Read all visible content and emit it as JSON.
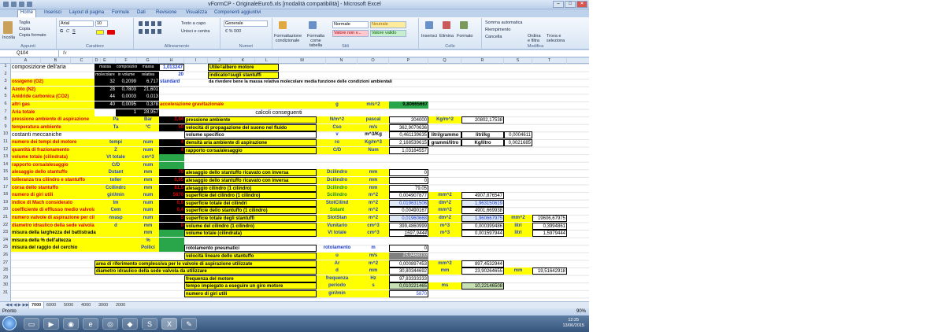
{
  "window": {
    "title": "vFormCP - OriginaleEuro5.xls [modalità compatibilità] - Microsoft Excel"
  },
  "tabs": [
    "Home",
    "Inserisci",
    "Layout di pagina",
    "Formule",
    "Dati",
    "Revisione",
    "Visualizza",
    "Componenti aggiuntivi"
  ],
  "ribbon": {
    "paste": "Incolla",
    "cut": "Taglia",
    "copy": "Copia",
    "format_painter": "Copia formato",
    "clipboard": "Appunti",
    "font_name": "Arial",
    "font_size": "10",
    "font_group": "Carattere",
    "wrap_text": "Testo a capo",
    "merge": "Unisci e centra",
    "align_group": "Allineamento",
    "number_format": "Generale",
    "number_group": "Numeri",
    "cond_format": "Formattazione condizionale",
    "format_table": "Formatta come tabella",
    "style_normal": "Normale",
    "style_neutral": "Neutrale",
    "style_bad": "Valore non v...",
    "style_good": "Valore valido",
    "styles_group": "Stili",
    "insert": "Inserisci",
    "delete": "Elimina",
    "format": "Formato",
    "cells_group": "Celle",
    "autosum": "Somma automatica",
    "fill": "Riempimento",
    "clear": "Cancella",
    "sort": "Ordina e filtra",
    "find": "Trova e seleziona",
    "edit_group": "Modifica"
  },
  "formula_bar": {
    "name_box": "Q104",
    "fx": "fx"
  },
  "columns": [
    "A",
    "B",
    "C",
    "D",
    "E",
    "F",
    "G",
    "H",
    "I",
    "J",
    "K",
    "L",
    "M",
    "N",
    "O",
    "P",
    "Q",
    "R",
    "S",
    "T"
  ],
  "rows": [
    "1",
    "2",
    "3",
    "4",
    "5",
    "6",
    "7",
    "8",
    "9",
    "10",
    "11",
    "12",
    "13",
    "14",
    "15",
    "16",
    "17",
    "18",
    "19",
    "20",
    "21",
    "22",
    "23",
    "24",
    "25",
    "26",
    "27",
    "28",
    "29",
    "30",
    "31"
  ],
  "cells": {
    "r1a": "composizione dell'aria",
    "r1e": "massa",
    "r1f": "composizione",
    "r1g": "massa",
    "r1h": "1,013247",
    "r1utile": "Utile=albero motore",
    "r2e": "molecolare",
    "r2f": "in volume",
    "r2g": "relativa",
    "r2h": "20",
    "r2ind": "indicato=sugli stantuffi",
    "r3a": "ossigeno (O2)",
    "r3e": "32",
    "r3f": "0,2099",
    "r3g": "6,717",
    "r3h": "standard",
    "r3note": "da rivedere bene la massa relativa molecolare media funzione delle condizioni ambientali",
    "r4a": "Azoto (N2)",
    "r4e": "28",
    "r4f": "0,7803",
    "r4g": "21,601",
    "r5a": "Anidride carbonica (CO2)",
    "r5e": "44",
    "r5f": "0,0003",
    "r5g": "0,013",
    "r6a": "altri gas",
    "r6e": "40",
    "r6f": "0,0095",
    "r6g": "0,378",
    "r6i": "accelerazione gravitazionale",
    "r6n": "g",
    "r6o": "m/s^2",
    "r6p": "9,80665667",
    "r7a": "Aria totale",
    "r7f": "1",
    "r7g": "28,957",
    "r7calc": "calcoli conseguenti",
    "r8a": "pressione ambiente di aspirazione",
    "r8e": "Pa",
    "r8g": "Bar",
    "r8h": "2,04",
    "r8i": "pressione ambiente",
    "r8n": "N/m^2",
    "r8o": "pascal",
    "r8p": "204000",
    "r8q": "Kg/m^2",
    "r8r": "20802,17538",
    "r9a": "temperatura ambiente",
    "r9e": "Ta",
    "r9g": "°C",
    "r9h": "50",
    "r9i": "velocità di propagazione del suono nel fluido",
    "r9n": "Cso",
    "r9o": "m/s",
    "r9p": "362,9070636",
    "r10a": "costanti meccaniche",
    "r10i": "volume specifico",
    "r10n": "v",
    "r10o": "m^3/Kg",
    "r10p": "0,461139635",
    "r10q": "litri/grammo",
    "r10r": "litri/kg",
    "r10s": "0,0004611",
    "r11a": "numero dei tempi del motore",
    "r11e": "tempi",
    "r11g": "num",
    "r11h": "4",
    "r11i": "densità aria ambiente di aspirazione",
    "r11n": "ro",
    "r11o": "Kg/m^3",
    "r11p": "2,168539615",
    "r11q": "grammi/litro",
    "r11r": "Kg/litro",
    "r11s": "0,0021685",
    "r12a": "quantità di frazionamento",
    "r12e": "Z",
    "r12g": "num",
    "r12h": "4",
    "r12i": "rapporto corsa/alesaggio",
    "r12n": "C/D",
    "r12o": "Num",
    "r12p": "1,03164557",
    "r13a": "volume totale (cilindrata)",
    "r13e": "Vt totale",
    "r13g": "cm^3",
    "r14a": "rapporto corsa/alesaggio",
    "r14e": "C/D",
    "r14g": "num",
    "r15a": "alesaggio dello stantuffo",
    "r15e": "Dstant",
    "r15g": "mm",
    "r15h": "79",
    "r15i": "alesaggio dello stantuffo ricavato con inversa",
    "r15n": "Dcilindro",
    "r15o": "mm",
    "r15p": "0",
    "r16a": "tolleranza tra cilindro e stantuffo",
    "r16e": "toller",
    "r16g": "mm",
    "r16h": "0,05",
    "r16i": "alesaggio dello stantuffo ricavato con inversa",
    "r16n": "Dcilindro",
    "r16o": "mm",
    "r16p": "0",
    "r17a": "corsa dello stantuffo",
    "r17e": "Ccilindrc",
    "r17g": "mm",
    "r17h": "81,5",
    "r17i": "alesaggio cilindro (1 cilindro)",
    "r17n": "Dcilindro",
    "r17o": "mm",
    "r17p": "79,05",
    "r18a": "numero di giri utili",
    "r18e": "giri/min",
    "r18g": "num",
    "r18h": "5870",
    "r18i": "superficie del cilindro (1 cilindro)",
    "r18n": "Scilindro",
    "r18o": "m^2",
    "r18p": "0,004907877",
    "r18q": "mm^2",
    "r18r": "4907,876547",
    "r19a": "indice di Mach considerato",
    "r19e": "Im",
    "r19g": "num",
    "r19h": "0,6",
    "r19i": "superficie totale dei cilindri",
    "r19n": "StotCilind",
    "r19o": "m^2",
    "r19p": "0,019631506",
    "r19q": "dm^2",
    "r19r": "1,963150619",
    "r20a": "coefficiente di efflusso medio valvola/e",
    "r20e": "Cem",
    "r20g": "num",
    "r20h": "0,4",
    "r20i": "superficie dello stantuffo (1 cilindro)",
    "r20n": "Sstant",
    "r20o": "m^2",
    "r20p": "0,00490167",
    "r20q": "mm^2",
    "r20r": "4901,669938",
    "r21a": "numero valvole di aspirazione per cilindr",
    "r21e": "nvasp",
    "r21g": "num",
    "r21h": "5",
    "r21i": "superficie totale degli stantuffi",
    "r21n": "StotStan",
    "r21o": "m^2",
    "r21p": "0,01960668",
    "r21q": "dm^2",
    "r21r": "1,960667975",
    "r21s": "mm^2",
    "r21t": "19606,67975",
    "r22a": "diametro idraulico della sede valvola da i",
    "r22e": "d",
    "r22g": "mm",
    "r22h": "0",
    "r22i": "volume del cilindro (1 cilindro)",
    "r22n": "Vunitario",
    "r22o": "cm^3",
    "r22p": "399,4860999",
    "r22q": "m^3",
    "r22r": "0,000399486",
    "r22s": "litri",
    "r22t": "0,3994861",
    "r23a": "misura della larghezza del battistrada",
    "r23g": "mm",
    "r23i": "volume totale (cilindrata)",
    "r23n": "Vt totale",
    "r23o": "cm^3",
    "r23p": "1597,9444",
    "r23q": "m^3",
    "r23r": "0,001597944",
    "r23s": "litri",
    "r23t": "1,5979444",
    "r24a": "misura della % dell'altezza",
    "r24g": "%",
    "r25a": "misura del raggio del cerchio",
    "r25g": "Pollici",
    "r25i": "rotolamento pneumatici",
    "r25n": "rotolamento",
    "r25o": "m",
    "r25p": "0",
    "r26i": "velocità lineare dello stantuffo",
    "r26n": "u",
    "r26o": "m/s",
    "r26p": "15,9468333",
    "r27a": "area di riferimento complessiva per le valvole di aspirazione utilizzate",
    "r27n": "Ar",
    "r27o": "m^2",
    "r27p": "0,000897453",
    "r27q": "mm^2",
    "r27r": "897,4532944",
    "r28a": "diametro idraulico della sede valvola da utilizzare",
    "r28n": "d",
    "r28o": "mm",
    "r28p": "30,80344692",
    "r28q": "mm",
    "r28r": "23,90264655",
    "r28s": "mm",
    "r28t": "19,51642918",
    "r29i": "frequenza del motore",
    "r29n": "frequenza",
    "r29o": "Hz",
    "r29p": "97,83333333",
    "r30i": "tempo impiegato a eseguire un giro motore",
    "r30n": "periodo",
    "r30o": "s",
    "r30p": "0,010221465",
    "r30q": "ms",
    "r30r": "10,22146508",
    "r31i": "numero di giri utili",
    "r31n": "giri/min",
    "r31p": "5870"
  },
  "sheet_tabs": [
    "7000",
    "6000",
    "5000",
    "4000",
    "3000",
    "2000"
  ],
  "status": {
    "ready": "Pronto",
    "zoom": "90%"
  },
  "taskbar": {
    "time": "12:25",
    "date": "13/06/2015"
  },
  "colors": {
    "yellow": "#ffff00",
    "black": "#000000",
    "green": "#2aa64a",
    "red": "#e00000",
    "blue": "#1f3fcf"
  }
}
